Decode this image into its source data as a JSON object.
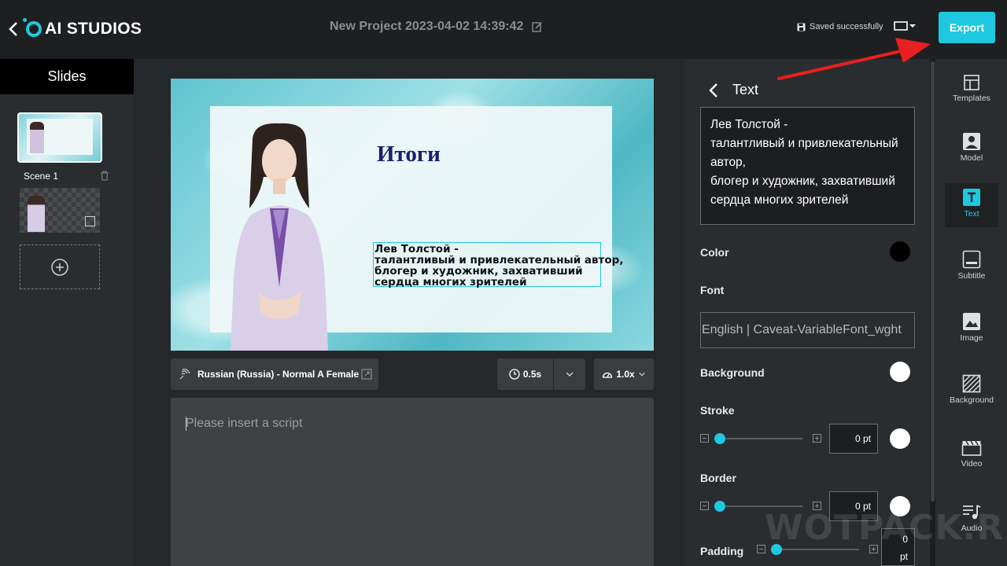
{
  "header": {
    "logo_text": "AI STUDIOS",
    "project_title": "New Project 2023-04-02 14:39:42",
    "saved_status": "Saved successfully",
    "export_label": "Export"
  },
  "slides": {
    "header": "Slides",
    "scene_label": "Scene 1"
  },
  "canvas": {
    "title": "Итоги",
    "text_lines": [
      "Лев Толстой -",
      "талантливый и привлекательный автор,",
      "блогер и художник, захвативший",
      "сердца многих зрителей"
    ]
  },
  "voice": {
    "label": "Russian (Russia) - Normal A Female",
    "pause": "0.5s",
    "speed": "1.0x"
  },
  "script": {
    "placeholder": "Please insert a script"
  },
  "props": {
    "title": "Text",
    "text_lines": [
      "Лев Толстой -",
      "талантливый и привлекательный",
      "автор,",
      "блогер и художник, захвативший",
      "сердца многих зрителей"
    ],
    "color_label": "Color",
    "color_value": "#000000",
    "font_label": "Font",
    "font_value": "English | Caveat-VariableFont_wght",
    "background_label": "Background",
    "background_value": "#ffffff",
    "stroke_label": "Stroke",
    "stroke_value": "0 pt",
    "border_label": "Border",
    "border_value": "0 pt",
    "padding_label": "Padding",
    "padding_value": "0",
    "padding_unit": "pt"
  },
  "rail": {
    "items": [
      {
        "label": "Templates",
        "icon": "templates-icon"
      },
      {
        "label": "Model",
        "icon": "model-icon"
      },
      {
        "label": "Text",
        "icon": "text-icon"
      },
      {
        "label": "Subtitle",
        "icon": "subtitle-icon"
      },
      {
        "label": "Image",
        "icon": "image-icon"
      },
      {
        "label": "Background",
        "icon": "background-icon"
      },
      {
        "label": "Video",
        "icon": "video-icon"
      },
      {
        "label": "Audio",
        "icon": "audio-icon"
      }
    ]
  },
  "colors": {
    "accent": "#1ec8e0",
    "arrow": "#e8201f"
  },
  "watermark": "WOTPACK.RU"
}
